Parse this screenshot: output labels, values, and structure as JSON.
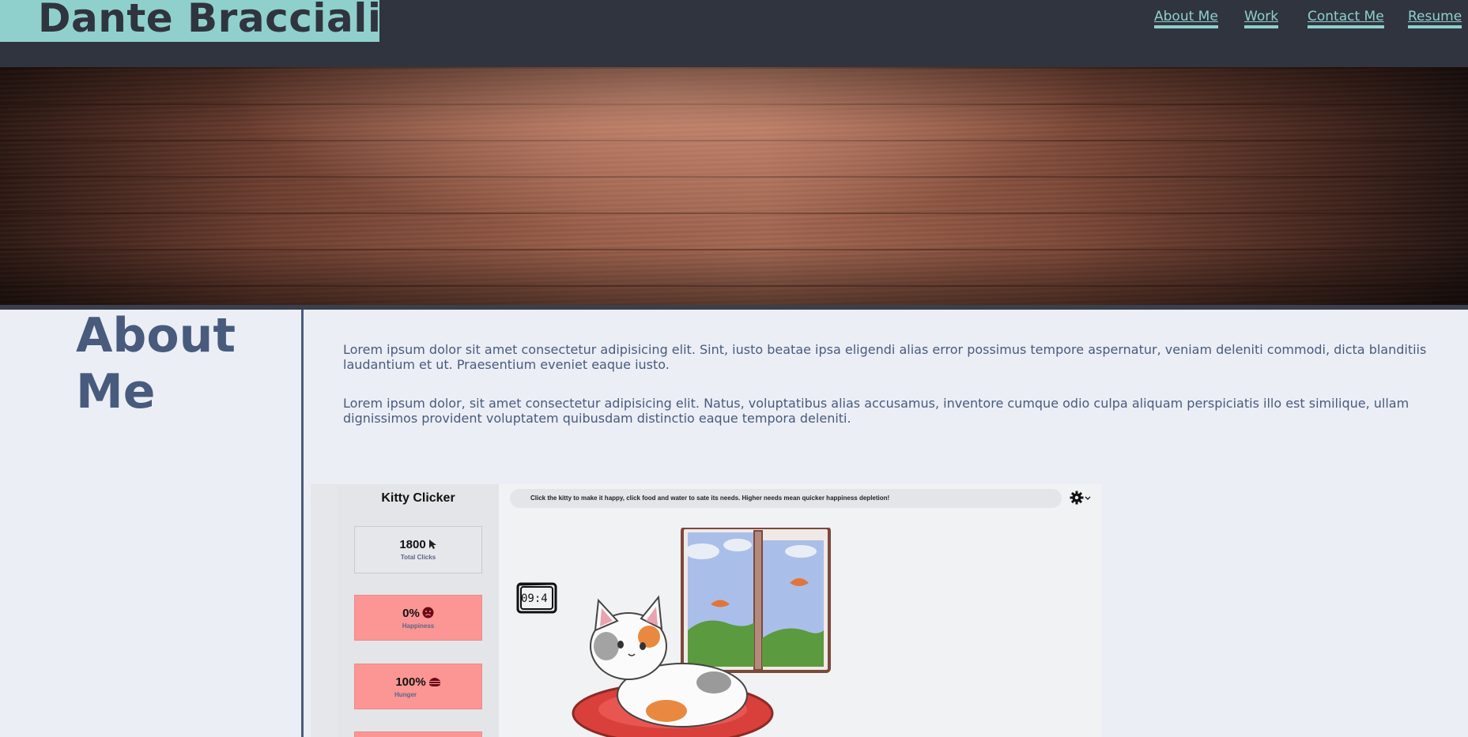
{
  "header": {
    "brand": "Dante Braccialini",
    "nav": [
      "About Me",
      "Work",
      "Contact Me",
      "Resume"
    ]
  },
  "about": {
    "heading": "About Me",
    "paragraphs": [
      "Lorem ipsum dolor sit amet consectetur adipisicing elit. Sint, iusto beatae ipsa eligendi alias error possimus tempore aspernatur, veniam deleniti commodi, dicta blanditiis laudantium et ut. Praesentium eveniet eaque iusto.",
      "Lorem ipsum dolor, sit amet consectetur adipisicing elit. Natus, voluptatibus alias accusamus, inventore cumque odio culpa aliquam perspiciatis illo est similique, ullam dignissimos provident voluptatem quibusdam distinctio eaque tempora deleniti."
    ]
  },
  "project_screenshot": {
    "title": "Kitty Clicker",
    "banner": "Click the kitty to make it happy, click food and water to sate its needs. Higher needs mean quicker happiness depletion!",
    "clock": "09:4",
    "stats": [
      {
        "value": "1800",
        "label": "Total Clicks",
        "icon": "cursor-icon"
      },
      {
        "value": "0%",
        "label": "Happiness",
        "icon": "sad-face-icon"
      },
      {
        "value": "100%",
        "label": "Hunger",
        "icon": "burger-icon"
      }
    ],
    "icons": [
      "gear-icon",
      "chevron-down-icon"
    ]
  },
  "colors": {
    "header_bg": "#30343f",
    "accent": "#8fd0cc",
    "body_bg": "#eceef5",
    "text": "#485b7d",
    "stat_red": "#fb9694"
  }
}
